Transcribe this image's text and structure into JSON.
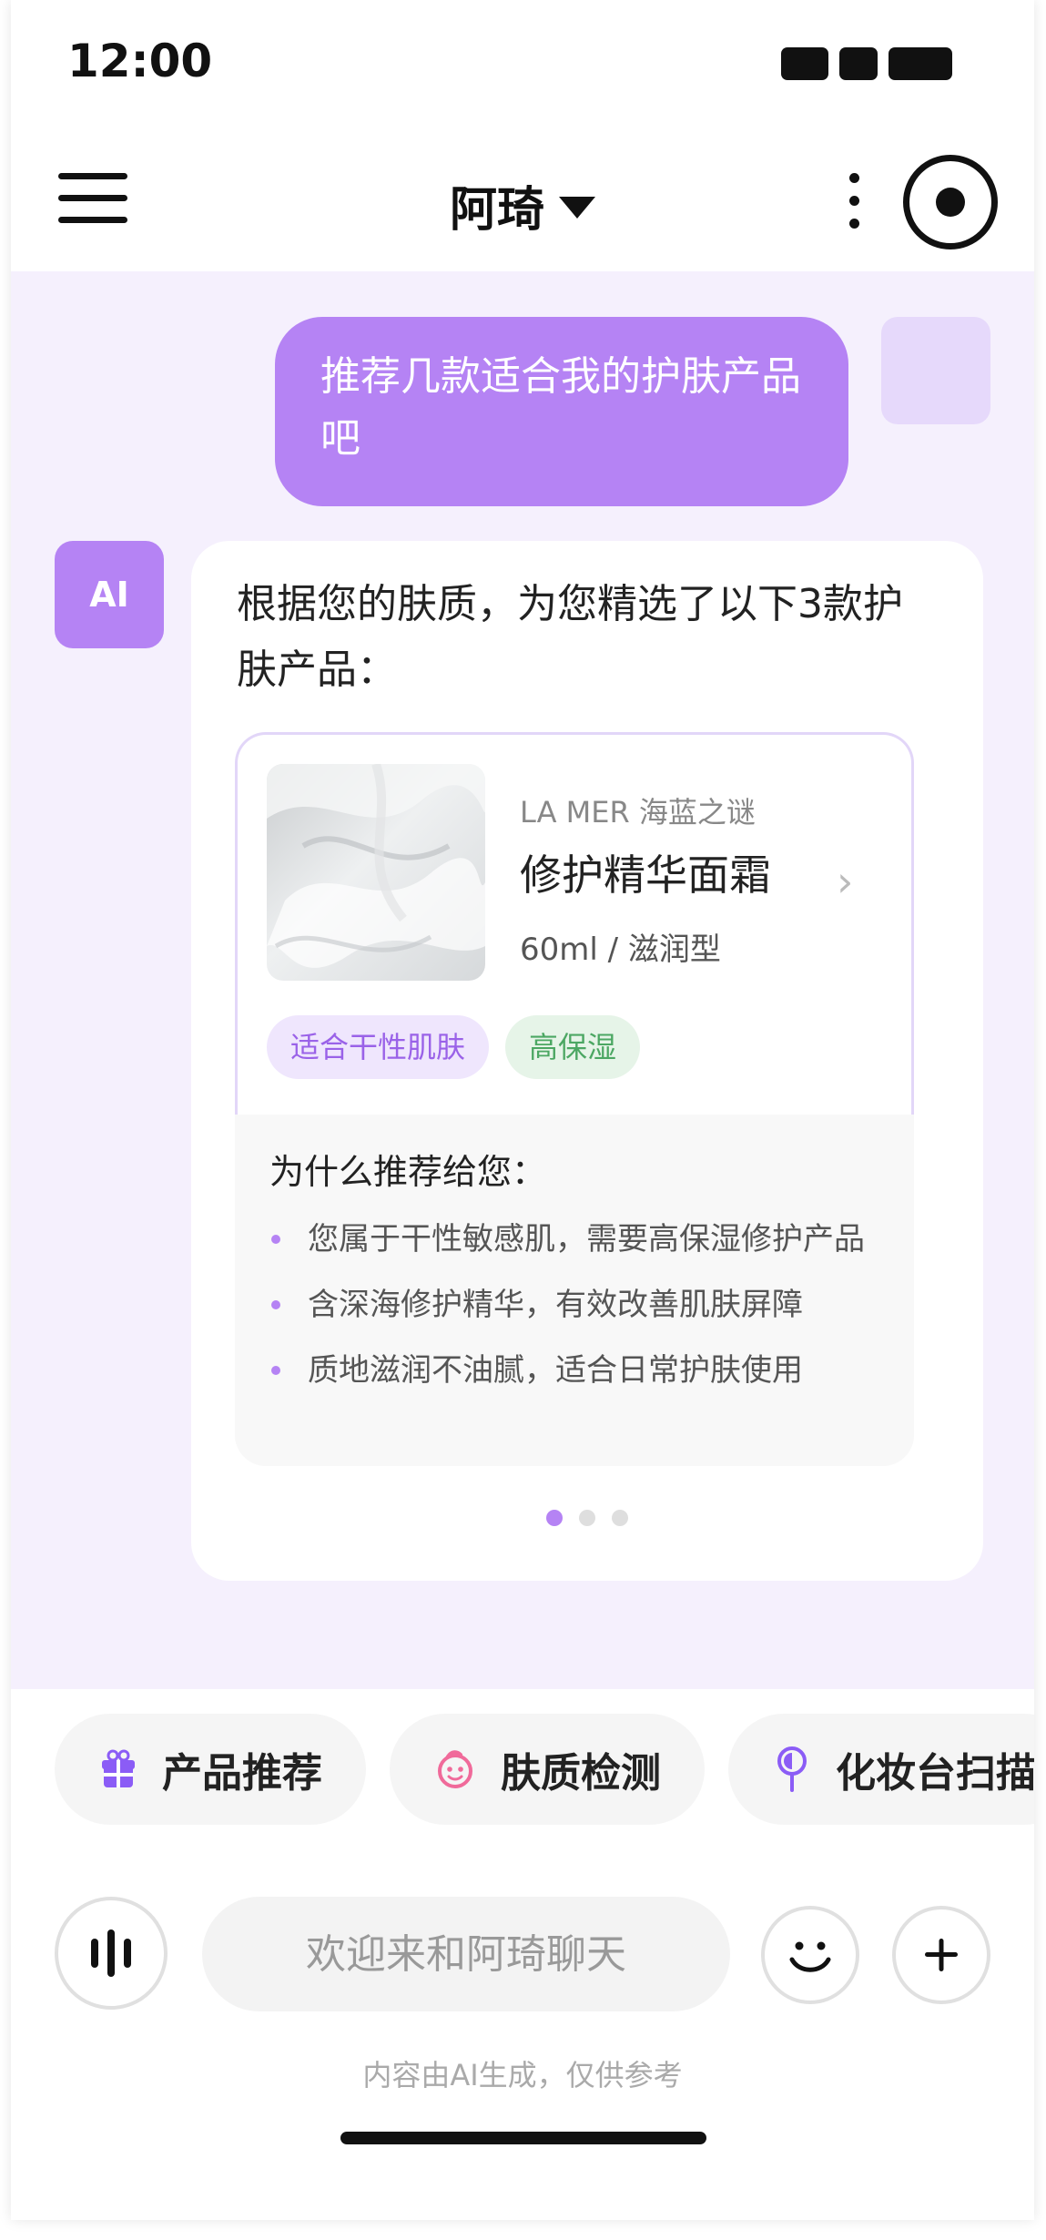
{
  "status_bar": {
    "time": "12:00"
  },
  "header": {
    "title": "阿琦"
  },
  "chat": {
    "user_message": "推荐几款适合我的护肤产品吧",
    "ai_avatar_label": "AI",
    "ai_intro": "根据您的肤质，为您精选了以下3款护肤产品：",
    "product": {
      "brand": "LA MER 海蓝之谜",
      "name": "修护精华面霜",
      "spec": "60ml / 滋润型",
      "tags": [
        "适合干性肌肤",
        "高保湿"
      ],
      "reason_title": "为什么推荐给您：",
      "reasons": [
        "您属于干性敏感肌，需要高保湿修护产品",
        "含深海修护精华，有效改善肌肤屏障",
        "质地滋润不油腻，适合日常护肤使用"
      ]
    },
    "carousel": {
      "current": 1,
      "total": 3
    }
  },
  "quick_actions": [
    {
      "label": "产品推荐",
      "icon": "gift-icon"
    },
    {
      "label": "肤质检测",
      "icon": "face-icon"
    },
    {
      "label": "化妆台扫描",
      "icon": "location-pin-icon"
    }
  ],
  "input": {
    "placeholder": "欢迎来和阿琦聊天"
  },
  "disclaimer": "内容由AI生成，仅供参考",
  "colors": {
    "accent": "#b583f4",
    "chat_background": "#f5f0fd",
    "tag_purple_text": "#9a62e8",
    "tag_green_text": "#4ca763"
  }
}
